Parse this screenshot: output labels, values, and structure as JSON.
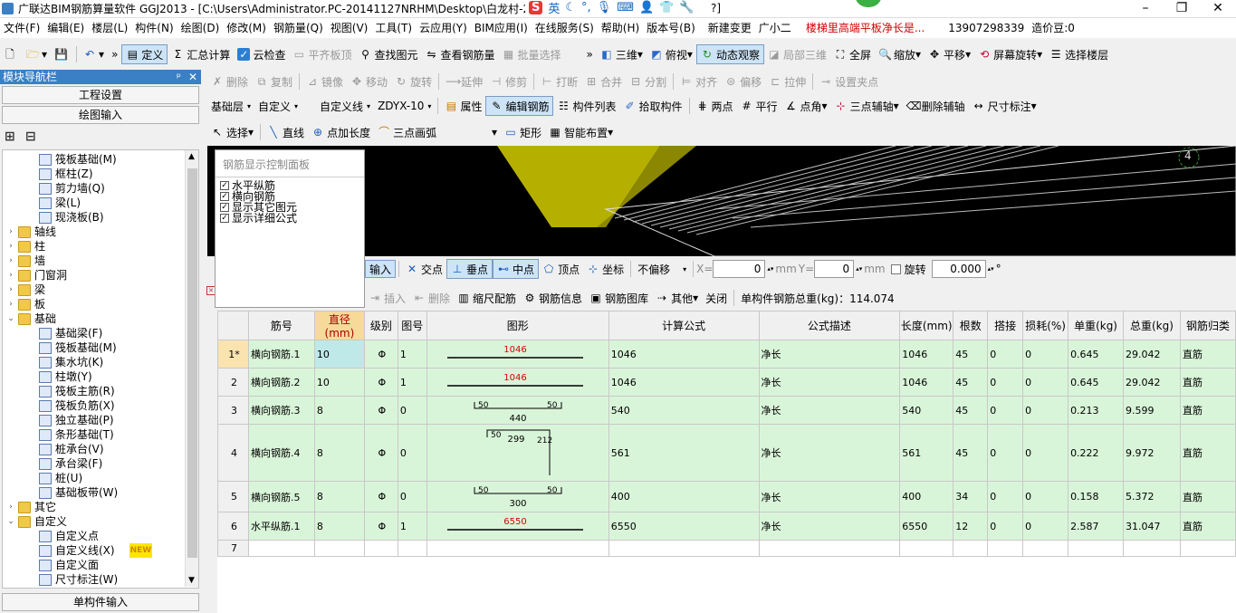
{
  "title": "广联达BIM钢筋算量软件 GGJ2013 - [C:\\Users\\Administrator.PC-20141127NRHM\\Desktop\\白龙村-2",
  "title_tail": "?]",
  "ime": {
    "lang": "英"
  },
  "menu": [
    "文件(F)",
    "编辑(E)",
    "楼层(L)",
    "构件(N)",
    "绘图(D)",
    "修改(M)",
    "钢筋量(Q)",
    "视图(V)",
    "工具(T)",
    "云应用(Y)",
    "BIM应用(I)",
    "在线服务(S)",
    "帮助(H)",
    "版本号(B)",
    "新建变更",
    "广小二",
    "楼梯里高端平板净长是...",
    "13907298339",
    "造价豆:0"
  ],
  "toolbar1": {
    "define": "定义",
    "sum": "汇总计算",
    "cloud_check": "云检查",
    "flat_top": "平齐板顶",
    "find": "查找图元",
    "view_rebar": "查看钢筋量",
    "batch_select": "批量选择",
    "three_d": "三维",
    "top_view": "俯视",
    "dynamic_view": "动态观察",
    "local_3d": "局部三维",
    "fullscreen": "全屏",
    "zoom": "缩放",
    "pan": "平移",
    "rotate_screen": "屏幕旋转",
    "select_floor": "选择楼层"
  },
  "nav": {
    "header": "模块导航栏",
    "project_settings": "工程设置",
    "draw_input": "绘图输入",
    "single_input": "单构件输入"
  },
  "tree": [
    {
      "label": "筏板基础(M)",
      "level": 2,
      "type": "leaf"
    },
    {
      "label": "框柱(Z)",
      "level": 2,
      "type": "leaf"
    },
    {
      "label": "剪力墙(Q)",
      "level": 2,
      "type": "leaf"
    },
    {
      "label": "梁(L)",
      "level": 2,
      "type": "leaf"
    },
    {
      "label": "现浇板(B)",
      "level": 2,
      "type": "leaf"
    },
    {
      "label": "轴线",
      "level": 1,
      "type": "folder",
      "arrow": "›"
    },
    {
      "label": "柱",
      "level": 1,
      "type": "folder",
      "arrow": "›"
    },
    {
      "label": "墙",
      "level": 1,
      "type": "folder",
      "arrow": "›"
    },
    {
      "label": "门窗洞",
      "level": 1,
      "type": "folder",
      "arrow": "›"
    },
    {
      "label": "梁",
      "level": 1,
      "type": "folder",
      "arrow": "›"
    },
    {
      "label": "板",
      "level": 1,
      "type": "folder",
      "arrow": "›"
    },
    {
      "label": "基础",
      "level": 1,
      "type": "folder",
      "arrow": "⌄"
    },
    {
      "label": "基础梁(F)",
      "level": 2,
      "type": "leaf"
    },
    {
      "label": "筏板基础(M)",
      "level": 2,
      "type": "leaf"
    },
    {
      "label": "集水坑(K)",
      "level": 2,
      "type": "leaf"
    },
    {
      "label": "柱墩(Y)",
      "level": 2,
      "type": "leaf"
    },
    {
      "label": "筏板主筋(R)",
      "level": 2,
      "type": "leaf"
    },
    {
      "label": "筏板负筋(X)",
      "level": 2,
      "type": "leaf"
    },
    {
      "label": "独立基础(P)",
      "level": 2,
      "type": "leaf"
    },
    {
      "label": "条形基础(T)",
      "level": 2,
      "type": "leaf"
    },
    {
      "label": "桩承台(V)",
      "level": 2,
      "type": "leaf"
    },
    {
      "label": "承台梁(F)",
      "level": 2,
      "type": "leaf"
    },
    {
      "label": "桩(U)",
      "level": 2,
      "type": "leaf"
    },
    {
      "label": "基础板带(W)",
      "level": 2,
      "type": "leaf"
    },
    {
      "label": "其它",
      "level": 1,
      "type": "folder",
      "arrow": "›"
    },
    {
      "label": "自定义",
      "level": 1,
      "type": "folder",
      "arrow": "⌄"
    },
    {
      "label": "自定义点",
      "level": 2,
      "type": "leaf"
    },
    {
      "label": "自定义线(X)",
      "level": 2,
      "type": "leaf",
      "badge": "NEW"
    },
    {
      "label": "自定义面",
      "level": 2,
      "type": "leaf"
    },
    {
      "label": "尺寸标注(W)",
      "level": 2,
      "type": "leaf"
    }
  ],
  "toolbar2": [
    "删除",
    "复制",
    "镜像",
    "移动",
    "旋转",
    "延伸",
    "修剪",
    "打断",
    "合并",
    "分割",
    "对齐",
    "偏移",
    "拉伸",
    "设置夹点"
  ],
  "toolbar3": {
    "floor": "基础层",
    "category": "自定义",
    "type": "自定义线",
    "code": "ZDYX-10",
    "props": "属性",
    "edit_rebar": "编辑钢筋",
    "component_list": "构件列表",
    "pick": "拾取构件",
    "two_points": "两点",
    "parallel": "平行",
    "point_angle": "点角",
    "three_point_axis": "三点辅轴",
    "delete_axis": "删除辅轴",
    "dimension": "尺寸标注"
  },
  "toolbar4": {
    "select": "选择",
    "line": "直线",
    "point_length": "点加长度",
    "arc": "三点画弧",
    "rect": "矩形",
    "smart_layout": "智能布置"
  },
  "panel": {
    "title": "钢筋显示控制面板",
    "items": [
      "水平纵筋",
      "横向钢筋",
      "显示其它图元",
      "显示详细公式"
    ]
  },
  "viewport": {
    "axis_label": "4"
  },
  "snapbar": {
    "input": "输入",
    "intersection": "交点",
    "perpendicular": "垂点",
    "midpoint": "中点",
    "vertex": "顶点",
    "coordinate": "坐标",
    "offset": "不偏移",
    "x_label": "X=",
    "x_val": "0",
    "y_label": "Y=",
    "y_val": "0",
    "unit": "mm",
    "rotate": "旋转",
    "rotate_val": "0.000"
  },
  "actbar": {
    "insert": "插入",
    "delete": "删除",
    "scale": "缩尺配筋",
    "info": "钢筋信息",
    "library": "钢筋图库",
    "other": "其他",
    "close": "关闭",
    "total": "单构件钢筋总重(kg)：114.074"
  },
  "grid": {
    "headers": [
      "筋号",
      "直径(mm)",
      "级别",
      "图号",
      "图形",
      "计算公式",
      "公式描述",
      "长度(mm)",
      "根数",
      "搭接",
      "损耗(%)",
      "单重(kg)",
      "总重(kg)",
      "钢筋归类"
    ],
    "rows": [
      {
        "n": "1*",
        "name": "横向钢筋.1",
        "dia": "10",
        "grade": "Φ",
        "fig": "1",
        "shape": "line",
        "dims": [
          "1046"
        ],
        "formula": "1046",
        "desc": "净长",
        "len": "1046",
        "count": "45",
        "lap": "0",
        "loss": "0",
        "unit_w": "0.645",
        "total_w": "29.042",
        "cls": "直筋"
      },
      {
        "n": "2",
        "name": "横向钢筋.2",
        "dia": "10",
        "grade": "Φ",
        "fig": "1",
        "shape": "line",
        "dims": [
          "1046"
        ],
        "formula": "1046",
        "desc": "净长",
        "len": "1046",
        "count": "45",
        "lap": "0",
        "loss": "0",
        "unit_w": "0.645",
        "total_w": "29.042",
        "cls": "直筋"
      },
      {
        "n": "3",
        "name": "横向钢筋.3",
        "dia": "8",
        "grade": "Φ",
        "fig": "0",
        "shape": "hook",
        "dims": [
          "50",
          "440",
          "50"
        ],
        "formula": "540",
        "desc": "净长",
        "len": "540",
        "count": "45",
        "lap": "0",
        "loss": "0",
        "unit_w": "0.213",
        "total_w": "9.599",
        "cls": "直筋"
      },
      {
        "n": "4",
        "name": "横向钢筋.4",
        "dia": "8",
        "grade": "Φ",
        "fig": "0",
        "shape": "bend",
        "dims": [
          "50",
          "299",
          "212"
        ],
        "formula": "561",
        "desc": "净长",
        "len": "561",
        "count": "45",
        "lap": "0",
        "loss": "0",
        "unit_w": "0.222",
        "total_w": "9.972",
        "cls": "直筋"
      },
      {
        "n": "5",
        "name": "横向钢筋.5",
        "dia": "8",
        "grade": "Φ",
        "fig": "0",
        "shape": "hook",
        "dims": [
          "50",
          "300",
          "50"
        ],
        "formula": "400",
        "desc": "净长",
        "len": "400",
        "count": "34",
        "lap": "0",
        "loss": "0",
        "unit_w": "0.158",
        "total_w": "5.372",
        "cls": "直筋"
      },
      {
        "n": "6",
        "name": "水平纵筋.1",
        "dia": "8",
        "grade": "Φ",
        "fig": "1",
        "shape": "line",
        "dims": [
          "6550"
        ],
        "formula": "6550",
        "desc": "净长",
        "len": "6550",
        "count": "12",
        "lap": "0",
        "loss": "0",
        "unit_w": "2.587",
        "total_w": "31.047",
        "cls": "直筋"
      },
      {
        "n": "7",
        "blank": true
      }
    ]
  }
}
